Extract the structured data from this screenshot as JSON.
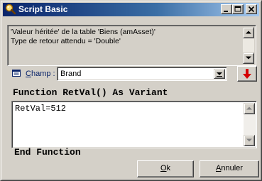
{
  "window": {
    "title": "Script Basic",
    "buttons": [
      "minimize",
      "maximize",
      "close"
    ]
  },
  "info": {
    "line1": "'Valeur héritée' de la table 'Biens (amAsset)'",
    "line2": "Type de retour attendu = 'Double'"
  },
  "field": {
    "label_underlined": "C",
    "label_rest": "hamp :",
    "value": "Brand"
  },
  "code": {
    "header": "Function RetVal() As Variant",
    "body": "RetVal=512",
    "footer": "End Function"
  },
  "buttons": {
    "ok_underlined": "O",
    "ok_rest": "k",
    "cancel_underlined": "A",
    "cancel_rest": "nnuler"
  },
  "colors": {
    "title_start": "#0a246a",
    "title_end": "#a6caf0",
    "face": "#d4d0c8",
    "arrow_red": "#d40000"
  },
  "icons": {
    "title": "magnifier-icon",
    "field": "field-icon",
    "action": "red-down-arrow-icon"
  }
}
